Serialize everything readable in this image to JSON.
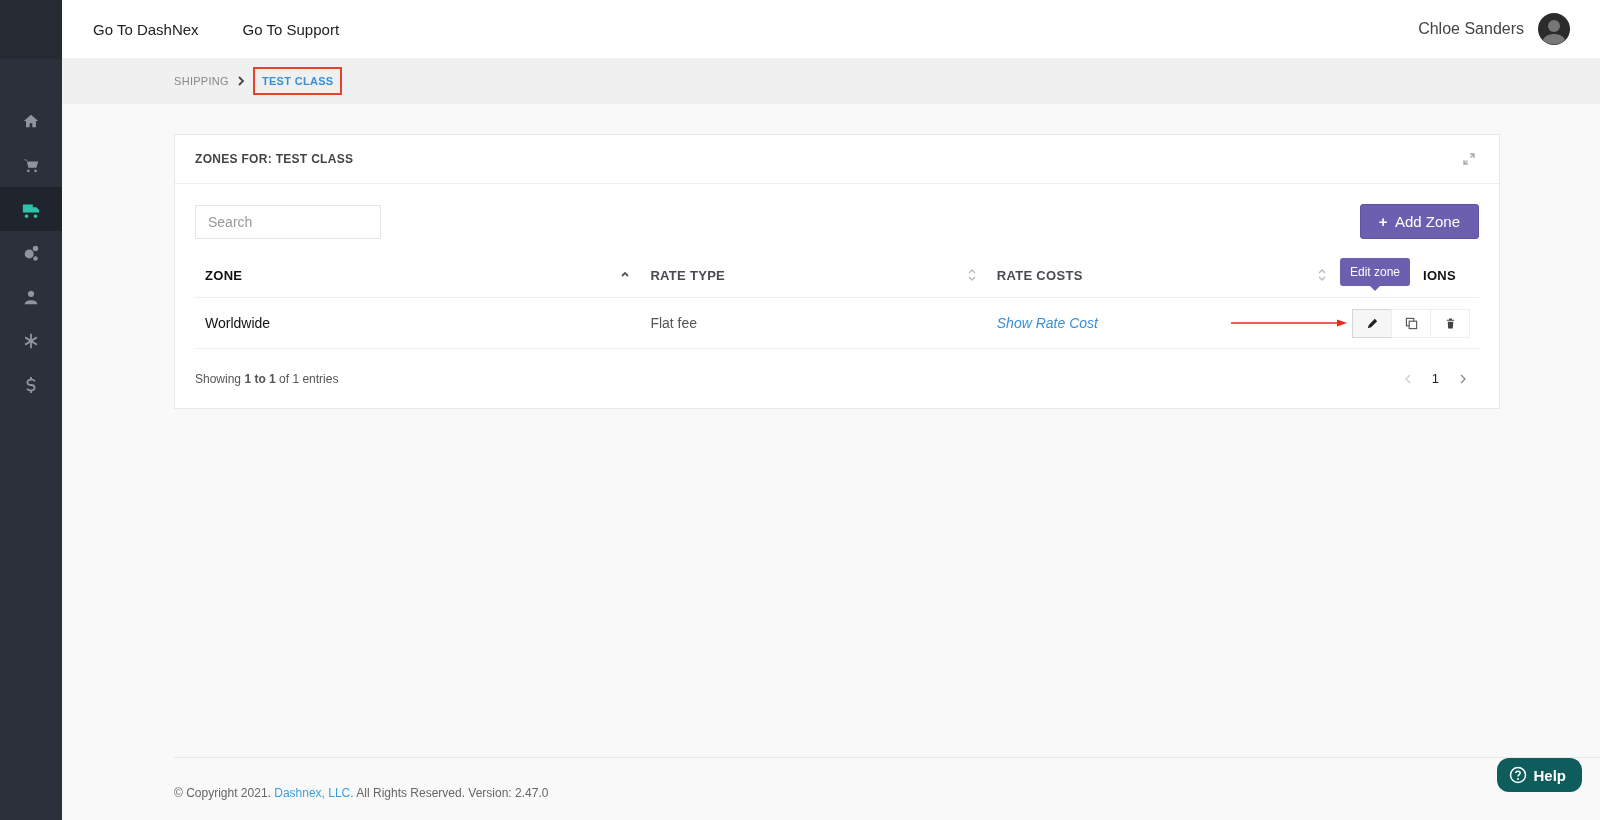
{
  "sidebar": {
    "items": [
      {
        "selected": false
      },
      {
        "selected": false
      },
      {
        "selected": true
      },
      {
        "selected": false
      },
      {
        "selected": false
      },
      {
        "selected": false
      },
      {
        "selected": false
      }
    ]
  },
  "top_nav": {
    "links": [
      "Go To DashNex",
      "Go To Support"
    ],
    "user_name": "Chloe Sanders"
  },
  "breadcrumb": [
    {
      "label": "SHIPPING",
      "current": false,
      "highlighted": false
    },
    {
      "label": "TEST CLASS",
      "current": true,
      "highlighted": true
    }
  ],
  "panel": {
    "title": "ZONES FOR: TEST CLASS",
    "search": {
      "placeholder": "Search"
    },
    "add_button": {
      "icon": "+",
      "label": "Add Zone"
    },
    "table": {
      "columns": [
        {
          "label": "ZONE",
          "sortable": true,
          "sorted": true
        },
        {
          "label": "RATE TYPE",
          "sortable": true,
          "sorted": false
        },
        {
          "label": "RATE COSTS",
          "sortable": true,
          "sorted": false
        },
        {
          "label": "IONS",
          "sortable": false,
          "sorted": false
        }
      ],
      "rows": [
        {
          "zone": "Worldwide",
          "rate_type": "Flat fee",
          "rate_costs": "Show Rate Cost",
          "actions": [
            {
              "kind": "edit",
              "focused": true
            },
            {
              "kind": "copy",
              "focused": false
            },
            {
              "kind": "delete",
              "focused": false
            }
          ]
        }
      ]
    },
    "tooltip": "Edit zone",
    "info": "Showing **1 to 1** of 1 entries",
    "pagination": {
      "pages": [
        {
          "label": "1",
          "selected": true
        }
      ]
    }
  },
  "footer": {
    "before": "© Copyright 2021.",
    "link": "Dashnex, LLC.",
    "after": "All Rights Reserved. Version: 2.47.0"
  },
  "help_button": {
    "label": "Help"
  }
}
